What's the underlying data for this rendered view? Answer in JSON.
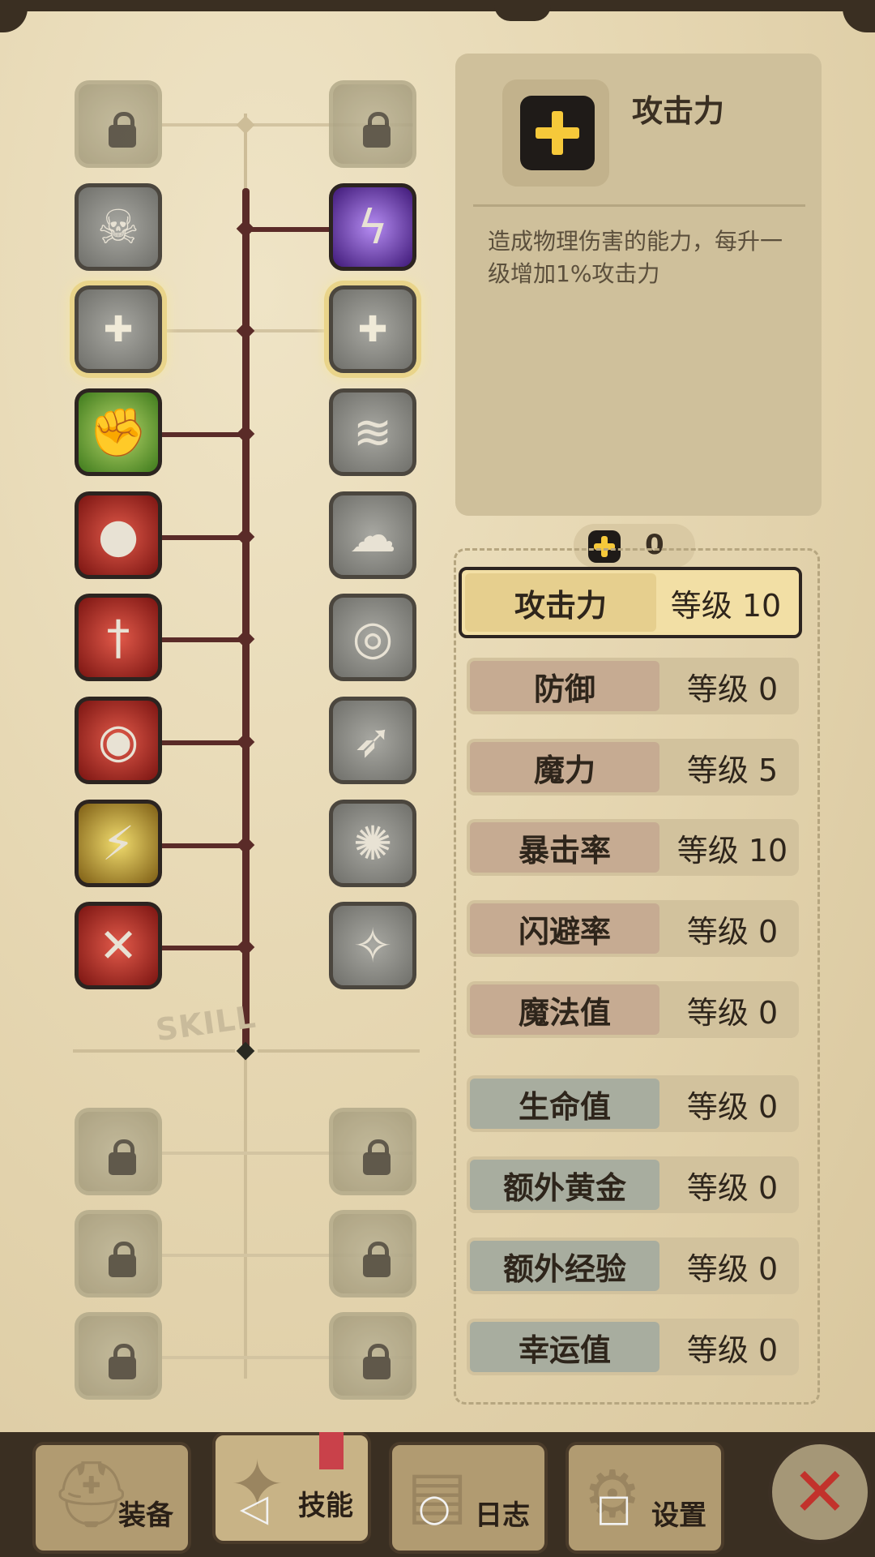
{
  "skill_tree": {
    "watermark": "SKILL",
    "left_column": [
      {
        "icon": "crossed-swords-icon",
        "state": "locked"
      },
      {
        "icon": "skeleton-runner-icon",
        "state": "inactive"
      },
      {
        "icon": "shield-plus-icon",
        "state": "highlighted"
      },
      {
        "icon": "muscle-arm-icon",
        "state": "active"
      },
      {
        "icon": "ninja-strike-icon",
        "state": "active"
      },
      {
        "icon": "sword-drop-icon",
        "state": "active"
      },
      {
        "icon": "shadow-dash-icon",
        "state": "active"
      },
      {
        "icon": "golden-warrior-icon",
        "state": "active"
      },
      {
        "icon": "cross-blade-icon",
        "state": "active"
      },
      {
        "icon": "bottle-lock-icon",
        "state": "locked"
      },
      {
        "icon": "bug-lock-icon",
        "state": "locked"
      },
      {
        "icon": "flame-lock-icon",
        "state": "locked"
      }
    ],
    "right_column": [
      {
        "icon": "shield-lock-icon",
        "state": "locked"
      },
      {
        "icon": "lightning-mage-icon",
        "state": "active"
      },
      {
        "icon": "shattered-plus-icon",
        "state": "highlighted"
      },
      {
        "icon": "speed-runner-icon",
        "state": "inactive"
      },
      {
        "icon": "smoke-figure-icon",
        "state": "inactive"
      },
      {
        "icon": "eye-orb-icon",
        "state": "inactive"
      },
      {
        "icon": "flying-blade-icon",
        "state": "inactive"
      },
      {
        "icon": "vortex-icon",
        "state": "inactive"
      },
      {
        "icon": "sparkle-figure-icon",
        "state": "inactive"
      },
      {
        "icon": "eye-lock-icon",
        "state": "locked"
      },
      {
        "icon": "eye-lock-2-icon",
        "state": "locked"
      },
      {
        "icon": "chain-lock-icon",
        "state": "locked"
      }
    ]
  },
  "detail": {
    "title": "攻击力",
    "description": "造成物理伤害的能力，每升一级增加1%攻击力",
    "icon": "yellow-plus-icon"
  },
  "points": {
    "icon": "yellow-plus-icon",
    "value": "0"
  },
  "stats": [
    {
      "name": "攻击力",
      "level": "等级 10",
      "group": "warm",
      "selected": true
    },
    {
      "name": "防御",
      "level": "等级 0",
      "group": "warm"
    },
    {
      "name": "魔力",
      "level": "等级 5",
      "group": "warm"
    },
    {
      "name": "暴击率",
      "level": "等级 10",
      "group": "warm"
    },
    {
      "name": "闪避率",
      "level": "等级 0",
      "group": "warm"
    },
    {
      "name": "魔法值",
      "level": "等级 0",
      "group": "warm"
    },
    {
      "name": "生命值",
      "level": "等级 0",
      "group": "cool"
    },
    {
      "name": "额外黄金",
      "level": "等级 0",
      "group": "cool"
    },
    {
      "name": "额外经验",
      "level": "等级 0",
      "group": "cool"
    },
    {
      "name": "幸运值",
      "level": "等级 0",
      "group": "cool"
    }
  ],
  "nav": {
    "tabs": [
      {
        "label": "装备",
        "icon": "helmet-icon"
      },
      {
        "label": "技能",
        "icon": "skill-icon",
        "active": true
      },
      {
        "label": "日志",
        "icon": "journal-icon"
      },
      {
        "label": "设置",
        "icon": "gear-icon"
      }
    ],
    "close_icon": "close-icon"
  },
  "system_nav": {
    "back": "◁",
    "home": "○",
    "recent": "□"
  }
}
